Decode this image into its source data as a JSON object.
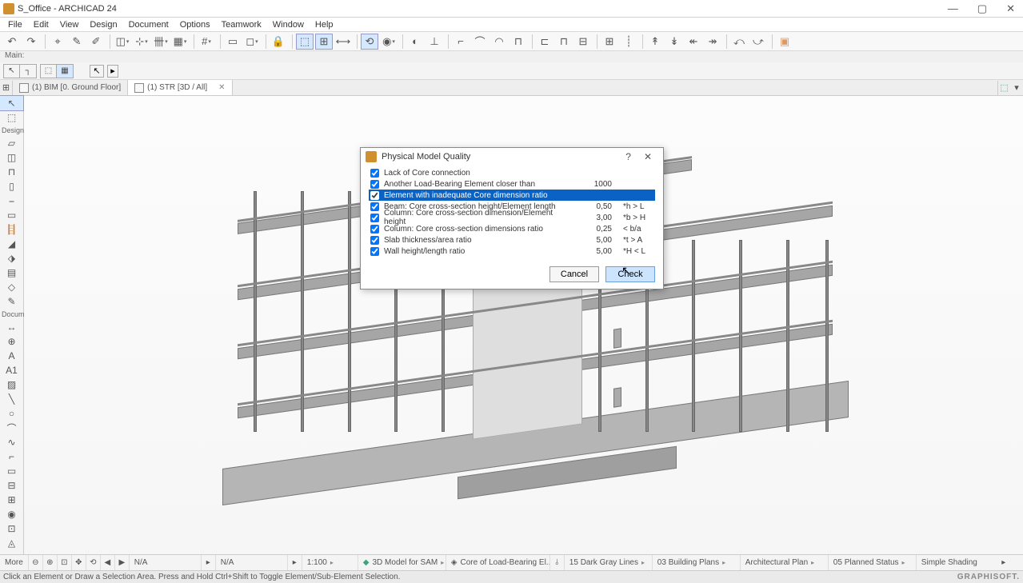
{
  "titlebar": {
    "title": "S_Office - ARCHICAD 24"
  },
  "menu": [
    "File",
    "Edit",
    "View",
    "Design",
    "Document",
    "Options",
    "Teamwork",
    "Window",
    "Help"
  ],
  "toolbar2_label": "Main:",
  "tabs": {
    "tab0": "(1) BIM [0. Ground Floor]",
    "tab1": "(1) STR [3D / All]"
  },
  "left_sections": {
    "design": "Design",
    "docume": "Docume"
  },
  "dialog": {
    "title": "Physical Model Quality",
    "items": [
      {
        "label": "Lack of Core connection",
        "checked": true,
        "value": "",
        "cond": ""
      },
      {
        "label": "Another Load-Bearing Element closer than",
        "checked": true,
        "value": "1000",
        "cond": ""
      },
      {
        "label": "Element with inadequate Core dimension ratio",
        "checked": true,
        "value": "",
        "cond": "",
        "selected": true
      },
      {
        "label": "Beam: Core cross-section height/Element length",
        "checked": true,
        "value": "0,50",
        "cond": "*h > L"
      },
      {
        "label": "Column: Core cross-section dimension/Element height",
        "checked": true,
        "value": "3,00",
        "cond": "*b > H"
      },
      {
        "label": "Column: Core cross-section dimensions ratio",
        "checked": true,
        "value": "0,25",
        "cond": "< b/a"
      },
      {
        "label": "Slab thickness/area ratio",
        "checked": true,
        "value": "5,00",
        "cond": "*t > A"
      },
      {
        "label": "Wall height/length ratio",
        "checked": true,
        "value": "5,00",
        "cond": "*H < L"
      }
    ],
    "cancel": "Cancel",
    "check": "Check"
  },
  "status": {
    "more": "More",
    "na1": "N/A",
    "na2": "N/A",
    "scale": "1:100",
    "view3d": "3D Model for SAM",
    "layers": "Core of Load-Bearing El...",
    "lineset": "15 Dark Gray Lines",
    "plans": "03 Building Plans",
    "archplan": "Architectural Plan",
    "planstatus": "05 Planned Status",
    "shading": "Simple Shading"
  },
  "hint": "Click an Element or Draw a Selection Area. Press and Hold Ctrl+Shift to Toggle Element/Sub-Element Selection.",
  "brand": "GRAPHISOFT."
}
